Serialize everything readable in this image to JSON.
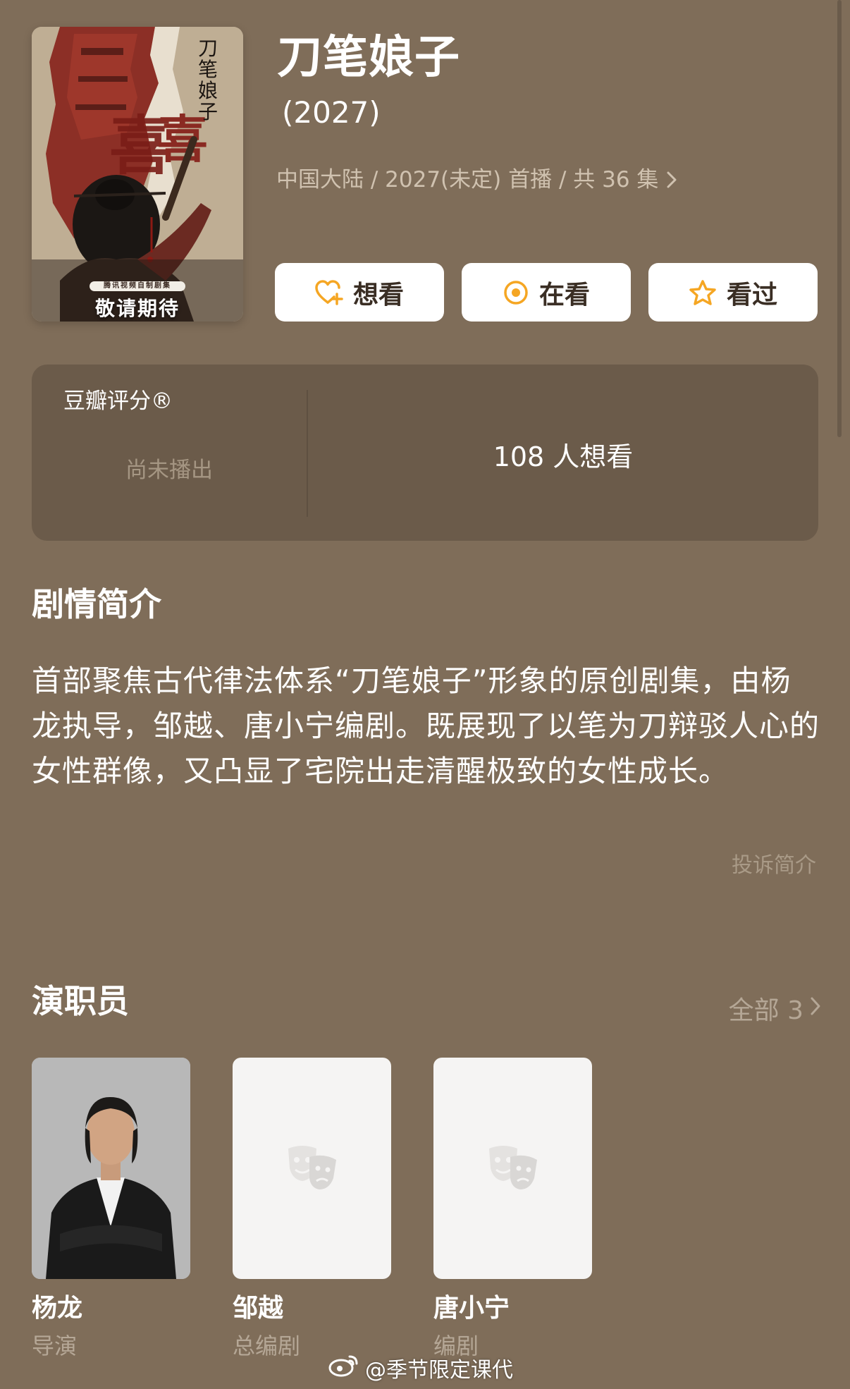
{
  "header": {
    "title": "刀笔娘子",
    "year": "(2027)",
    "meta": "中国大陆 / 2027(未定) 首播 / 共 36 集"
  },
  "poster": {
    "badge": "腾讯视频自制剧集",
    "caption": "敬请期待",
    "vertical_title": "刀笔娘子",
    "big_char": "喜"
  },
  "actions": [
    {
      "label": "想看",
      "icon": "heart-plus-icon"
    },
    {
      "label": "在看",
      "icon": "target-circle-icon"
    },
    {
      "label": "看过",
      "icon": "star-icon"
    }
  ],
  "rating": {
    "label": "豆瓣评分®",
    "status": "尚未播出",
    "want_count": "108 人想看"
  },
  "synopsis": {
    "heading": "剧情简介",
    "text": "首部聚焦古代律法体系“刀笔娘子”形象的原创剧集，由杨龙执导，邹越、唐小宁编剧。既展现了以笔为刀辩驳人心的女性群像，又凸显了宅院出走清醒极致的女性成长。",
    "complaint": "投诉简介"
  },
  "cast": {
    "heading": "演职员",
    "see_all": "全部 3",
    "members": [
      {
        "name": "杨龙",
        "role": "导演"
      },
      {
        "name": "邹越",
        "role": "总编剧"
      },
      {
        "name": "唐小宁",
        "role": "编剧"
      }
    ]
  },
  "watermark": "@季节限定课代",
  "colors": {
    "background": "#7f6d59",
    "card": "#6b5b4a",
    "accent": "#f5a623",
    "muted": "#b5a796"
  }
}
